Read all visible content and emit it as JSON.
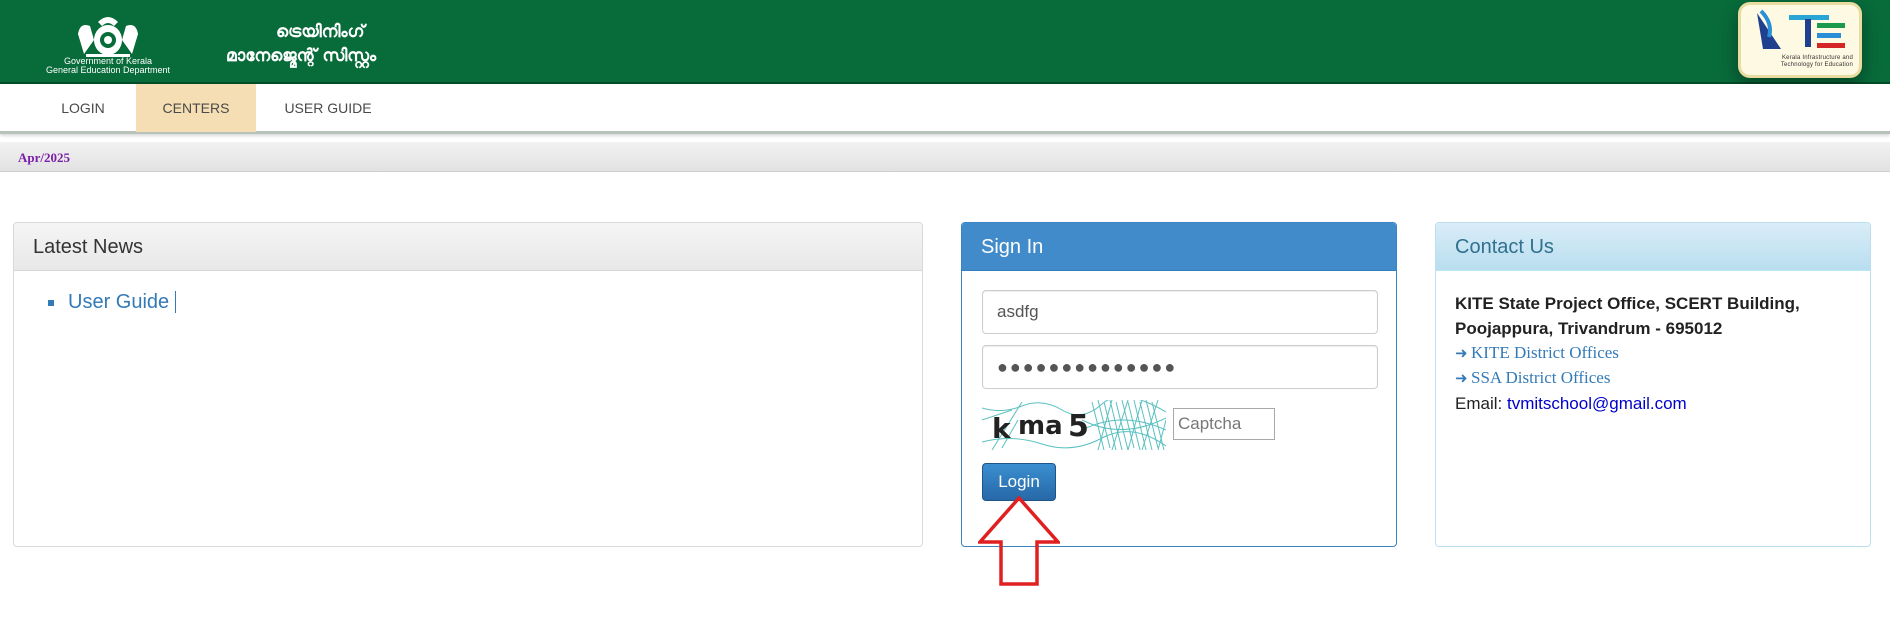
{
  "header": {
    "org_line1": "Government of Kerala",
    "org_line2": "General Education Department",
    "system_title_line1": "ട്രെയിനിംഗ്",
    "system_title_line2": "മാനേജ്മെന്റ് സിസ്റ്റം",
    "partner_logo_text": "Kerala Infrastructure and Technology for Education",
    "colors": {
      "header_bg": "#086b3a",
      "accent": "#428bca"
    }
  },
  "nav": {
    "items": [
      {
        "label": "LOGIN"
      },
      {
        "label": "CENTERS",
        "active": true
      },
      {
        "label": "USER GUIDE"
      }
    ]
  },
  "date_bar": {
    "text": "Apr/2025"
  },
  "news": {
    "title": "Latest News",
    "items": [
      {
        "label": "User Guide"
      }
    ]
  },
  "signin": {
    "title": "Sign In",
    "username_value": "asdfg",
    "password_mask": "●●●●●●●●●●●●●●",
    "captcha_text": "kma5",
    "captcha_placeholder": "Captcha",
    "login_label": "Login"
  },
  "contact": {
    "title": "Contact Us",
    "address_line1": "KITE State Project Office, SCERT Building,",
    "address_line2": "Poojappura, Trivandrum - 695012",
    "link_kite": "KITE District Offices",
    "link_ssa": "SSA District Offices",
    "email_label": "Email:",
    "email_value": "tvmitschool@gmail.com"
  },
  "icons": [
    "kerala-emblem-icon",
    "kite-logo-icon",
    "arrow-right-icon",
    "up-arrow-annotation-icon"
  ]
}
